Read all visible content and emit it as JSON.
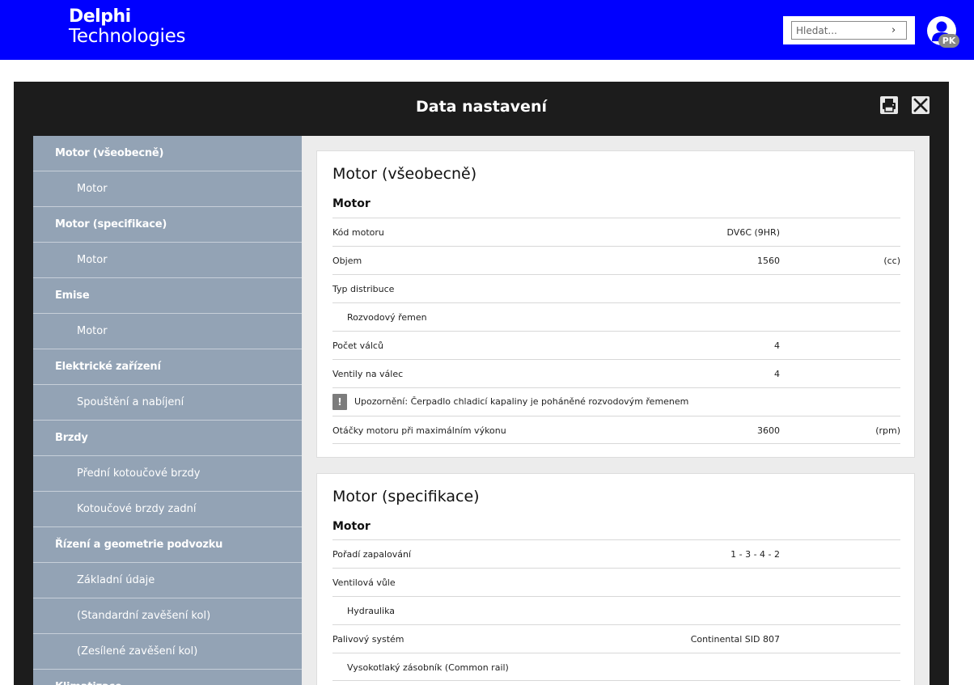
{
  "header": {
    "logo_line1": "Delphi",
    "logo_line2": "Technologies",
    "search_placeholder": "Hledat...",
    "search_arrow": "›",
    "avatar_initials": "PK",
    "brand_color": "#0000ff"
  },
  "modal": {
    "title": "Data nastavení",
    "print_icon": "printer-icon",
    "close_icon": "close-icon"
  },
  "sidebar": {
    "items": [
      {
        "label": "Motor (všeobecně)",
        "level": 0
      },
      {
        "label": "Motor",
        "level": 1
      },
      {
        "label": "Motor (specifikace)",
        "level": 0
      },
      {
        "label": "Motor",
        "level": 1
      },
      {
        "label": "Emise",
        "level": 0
      },
      {
        "label": "Motor",
        "level": 1
      },
      {
        "label": "Elektrické zařízení",
        "level": 0
      },
      {
        "label": "Spouštění a nabíjení",
        "level": 1
      },
      {
        "label": "Brzdy",
        "level": 0
      },
      {
        "label": "Přední kotoučové brzdy",
        "level": 1
      },
      {
        "label": "Kotoučové brzdy zadní",
        "level": 1
      },
      {
        "label": "Řízení a geometrie podvozku",
        "level": 0
      },
      {
        "label": "Základní údaje",
        "level": 1
      },
      {
        "label": "(Standardní zavěšení kol)",
        "level": 1
      },
      {
        "label": "(Zesílené zavěšení kol)",
        "level": 1
      },
      {
        "label": "Klimatizace",
        "level": 0
      }
    ]
  },
  "sections": [
    {
      "title": "Motor (všeobecně)",
      "subtitle": "Motor",
      "rows": [
        {
          "label": "Kód motoru",
          "value": "DV6C (9HR)",
          "unit": "",
          "indent": false,
          "warning": false
        },
        {
          "label": "Objem",
          "value": "1560",
          "unit": "(cc)",
          "indent": false,
          "warning": false
        },
        {
          "label": "Typ distribuce",
          "value": "",
          "unit": "",
          "indent": false,
          "warning": false
        },
        {
          "label": "Rozvodový řemen",
          "value": "",
          "unit": "",
          "indent": true,
          "warning": false
        },
        {
          "label": "Počet válců",
          "value": "4",
          "unit": "",
          "indent": false,
          "warning": false
        },
        {
          "label": "Ventily na válec",
          "value": "4",
          "unit": "",
          "indent": false,
          "warning": false
        },
        {
          "label": "Upozornění: Čerpadlo chladicí kapaliny je poháněné rozvodovým řemenem",
          "value": "",
          "unit": "",
          "indent": false,
          "warning": true,
          "warning_icon": "!"
        },
        {
          "label": "Otáčky motoru při maximálním výkonu",
          "value": "3600",
          "unit": "(rpm)",
          "indent": false,
          "warning": false
        }
      ]
    },
    {
      "title": "Motor (specifikace)",
      "subtitle": "Motor",
      "rows": [
        {
          "label": "Pořadí zapalování",
          "value": "1 - 3 - 4 - 2",
          "unit": "",
          "indent": false,
          "warning": false
        },
        {
          "label": "Ventilová vůle",
          "value": "",
          "unit": "",
          "indent": false,
          "warning": false
        },
        {
          "label": "Hydraulika",
          "value": "",
          "unit": "",
          "indent": true,
          "warning": false
        },
        {
          "label": "Palivový systém",
          "value": "Continental SID 807",
          "unit": "",
          "indent": false,
          "warning": false
        },
        {
          "label": "Vysokotlaký zásobník (Common rail)",
          "value": "",
          "unit": "",
          "indent": true,
          "warning": false
        }
      ]
    }
  ]
}
